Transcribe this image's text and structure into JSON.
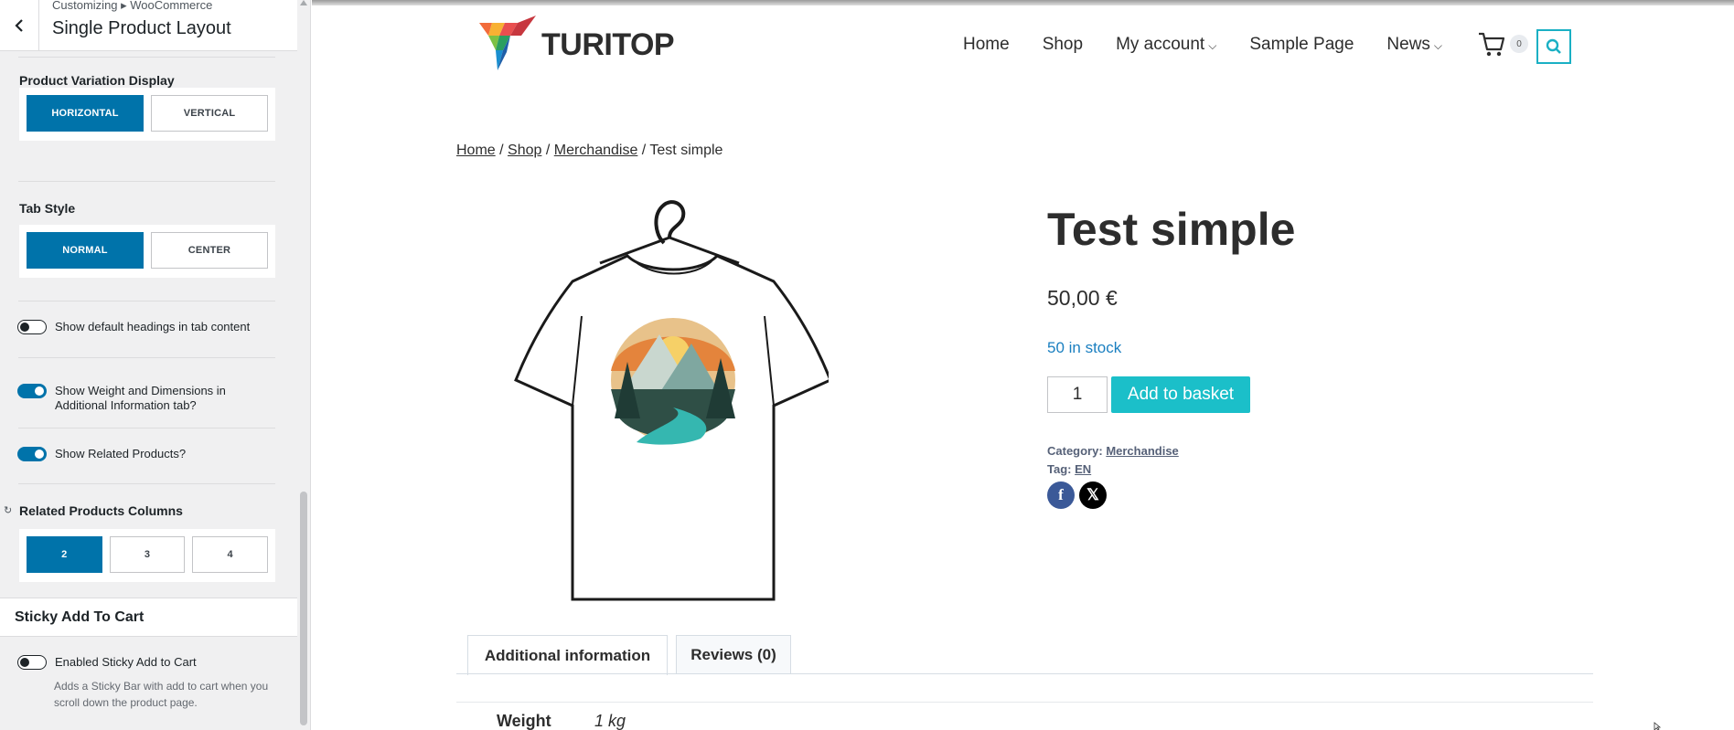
{
  "customizer": {
    "breadcrumb": "Customizing ▸ WooCommerce",
    "title": "Single Product Layout",
    "variation_display": {
      "label": "Product Variation Display",
      "options": [
        "HORIZONTAL",
        "VERTICAL"
      ],
      "selected": "HORIZONTAL"
    },
    "tab_style": {
      "label": "Tab Style",
      "options": [
        "NORMAL",
        "CENTER"
      ],
      "selected": "NORMAL"
    },
    "toggles": [
      {
        "label": "Show default headings in tab content",
        "on": false
      },
      {
        "label": "Show Weight and Dimensions in Additional Information tab?",
        "on": true
      },
      {
        "label": "Show Related Products?",
        "on": true
      }
    ],
    "related_columns": {
      "label": "Related Products Columns",
      "options": [
        "2",
        "3",
        "4"
      ],
      "selected": "2"
    },
    "sticky": {
      "section_title": "Sticky Add To Cart",
      "toggle_label": "Enabled Sticky Add to Cart",
      "toggle_on": false,
      "description": "Adds a Sticky Bar with add to cart when you scroll down the product page."
    }
  },
  "site": {
    "logo_text": "TURITOP",
    "nav": [
      "Home",
      "Shop",
      "My account",
      "Sample Page",
      "News"
    ],
    "cart_count": "0",
    "accent_color": "#1bbfc9"
  },
  "breadcrumb": {
    "home": "Home",
    "shop": "Shop",
    "category": "Merchandise",
    "current": "Test simple",
    "sep": " / "
  },
  "product": {
    "title": "Test simple",
    "price": "50,00 €",
    "stock": "50 in stock",
    "quantity": "1",
    "add_button": "Add to basket",
    "category_label": "Category:",
    "category": "Merchandise",
    "tag_label": "Tag:",
    "tag": "EN"
  },
  "tabs": [
    "Additional information",
    "Reviews (0)"
  ],
  "additional_info": {
    "weight_label": "Weight",
    "weight_value": "1 kg"
  }
}
